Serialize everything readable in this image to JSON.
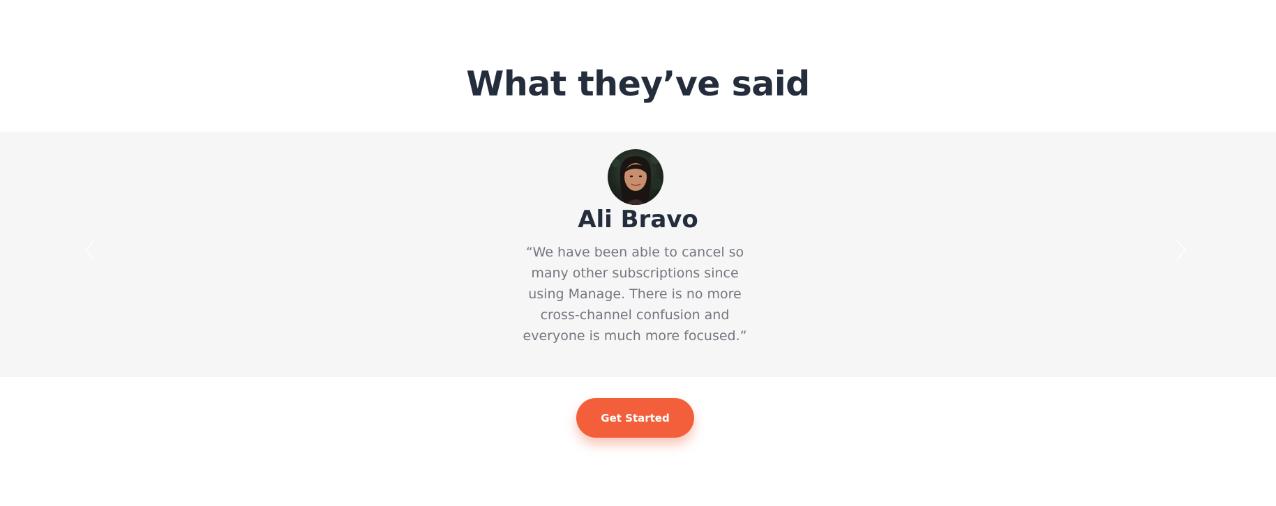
{
  "testimonials": {
    "title": "What they’ve said",
    "prev_icon": "chevron-left-icon",
    "next_icon": "chevron-right-icon",
    "active": {
      "name": "Ali Bravo",
      "quote": "“We have been able to cancel so many other subscriptions since using Manage. There is no more cross-channel confusion and everyone is much more focused.”",
      "avatar_alt": "Ali Bravo"
    }
  },
  "cta": {
    "label": "Get Started"
  },
  "colors": {
    "accent": "#f25f3a",
    "heading": "#242d3c",
    "body_text": "#737780",
    "carousel_bg": "#f6f6f6"
  }
}
